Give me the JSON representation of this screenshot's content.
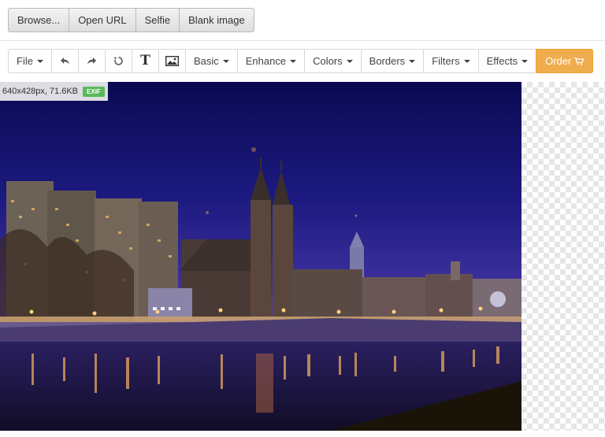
{
  "source_bar": {
    "buttons": [
      {
        "label": "Browse..."
      },
      {
        "label": "Open URL"
      },
      {
        "label": "Selfie"
      },
      {
        "label": "Blank image"
      }
    ]
  },
  "toolbar": {
    "file": "File",
    "undo_icon": "undo-icon",
    "redo_icon": "redo-icon",
    "reset_icon": "reset-icon",
    "text_icon": "T",
    "image_icon": "image-icon",
    "menus": [
      {
        "label": "Basic"
      },
      {
        "label": "Enhance"
      },
      {
        "label": "Colors"
      },
      {
        "label": "Borders"
      },
      {
        "label": "Filters"
      },
      {
        "label": "Effects"
      }
    ],
    "order": "Order",
    "order_icon": "cart-icon",
    "order_color": "#f0ad4e"
  },
  "image_info": {
    "dimensions_size": "640x428px, 71.6KB",
    "exif_badge": "EXIF",
    "exif_color": "#5cb85c"
  }
}
